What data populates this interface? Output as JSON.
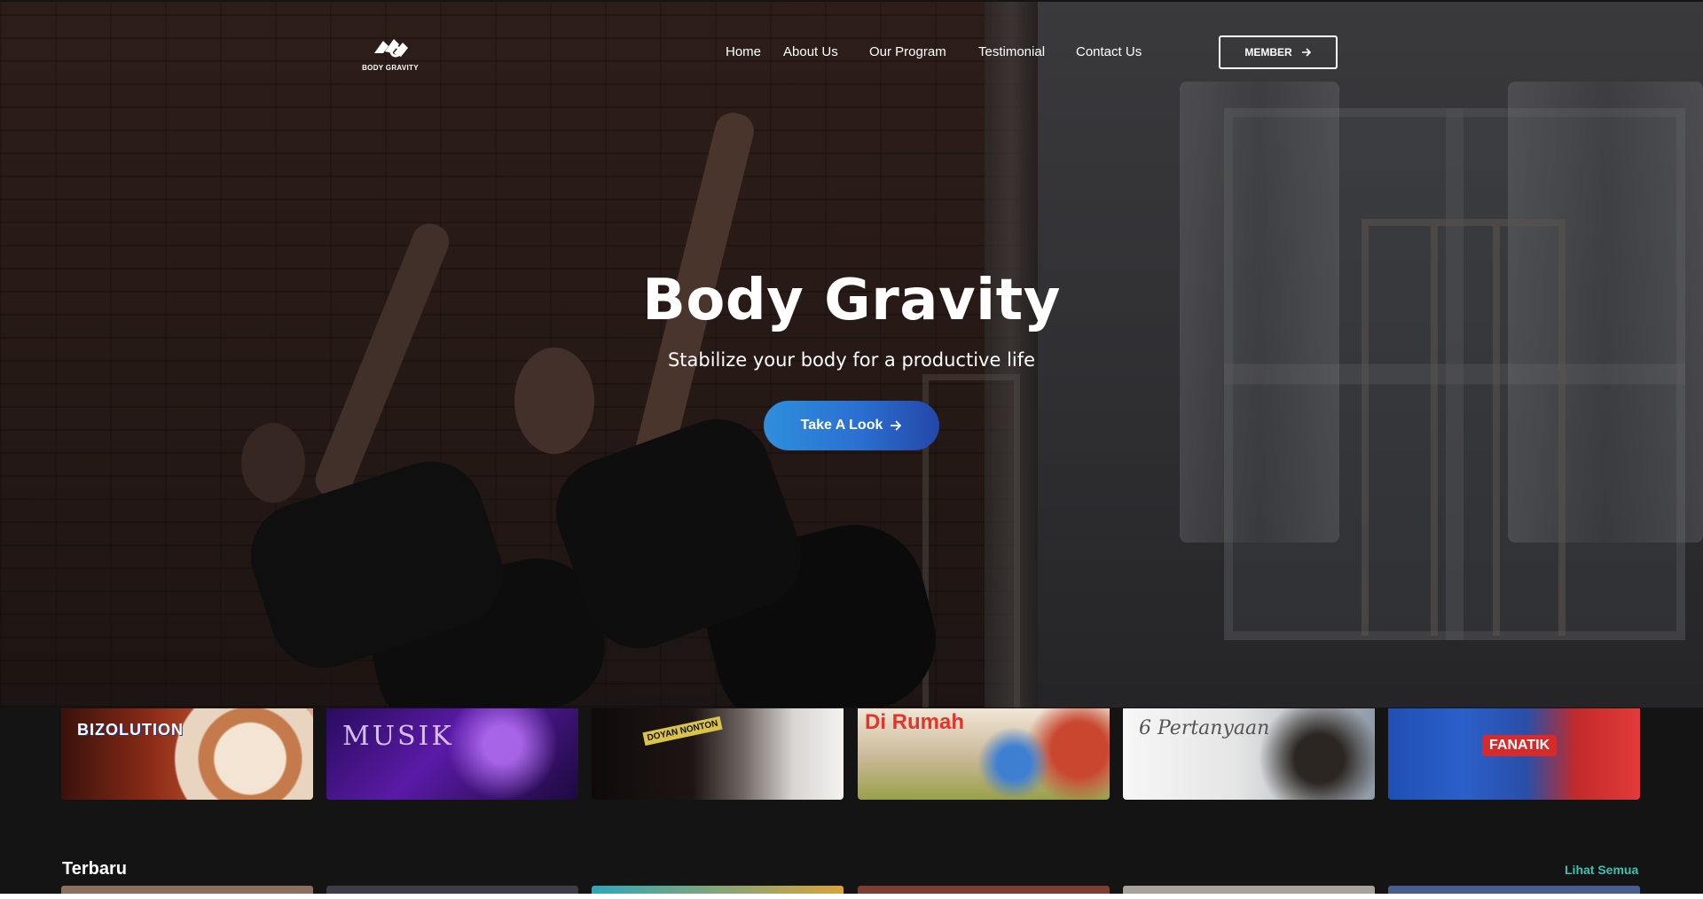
{
  "brand": {
    "name": "BODY GRAVITY",
    "icon": "body-gravity-logo-icon"
  },
  "nav": {
    "items": [
      {
        "label": "Home"
      },
      {
        "label": "About Us"
      },
      {
        "label": "Our Program"
      },
      {
        "label": "Testimonial"
      },
      {
        "label": "Contact Us"
      }
    ],
    "member_label": "MEMBER",
    "member_icon": "arrow-right-icon"
  },
  "hero": {
    "title": "Body Gravity",
    "subtitle": "Stabilize your body for a productive life",
    "cta_label": "Take A Look",
    "cta_icon": "arrow-right-icon",
    "cta_gradient": [
      "#2f8fdc",
      "#2447a8"
    ]
  },
  "carousel": {
    "items": [
      {
        "label": "BIZOLUTION",
        "theme": "coffee"
      },
      {
        "label": "MUSIK",
        "theme": "neon-purple"
      },
      {
        "label": "DOYAN NONTON",
        "theme": "dark-portrait"
      },
      {
        "label": "Di Rumah",
        "theme": "living-room"
      },
      {
        "label": "6 Pertanyaan",
        "theme": "misty-portrait"
      },
      {
        "label": "FANATIK",
        "theme": "football"
      }
    ]
  },
  "section": {
    "title": "Terbaru",
    "see_all_label": "Lihat Semua",
    "accent": "#3fc1b0"
  }
}
